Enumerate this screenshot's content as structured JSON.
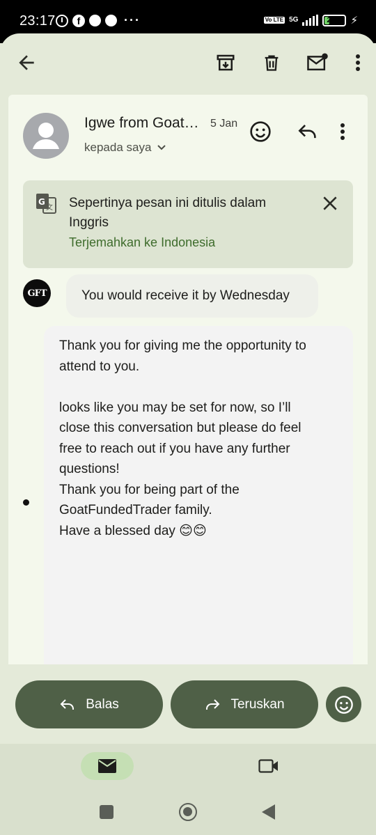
{
  "status_bar": {
    "time": "23:17",
    "network_type": "5G",
    "volte": "Vo LTE",
    "battery_percent": "24"
  },
  "header": {
    "sender": "Igwe from GoatFundedTrader",
    "date": "5 Jan",
    "recipient": "kepada saya"
  },
  "translate_banner": {
    "message": "Sepertinya pesan ini ditulis dalam Inggris",
    "action": "Terjemahkan ke Indonesia"
  },
  "messages": {
    "first": "You would receive it by Wednesday",
    "logo_text": "GFT",
    "second_lines": [
      "Thank you for giving me the opportunity to",
      "attend to you.",
      "",
      "looks like you may be set for now, so I’ll",
      "close this conversation but please do feel",
      "free to reach out if you have any further",
      "questions!",
      "Thank you for being part of the",
      "GoatFundedTrader family.",
      "Have a blessed day 😊😊"
    ]
  },
  "actions": {
    "reply_label": "Balas",
    "forward_label": "Teruskan"
  },
  "colors": {
    "app_background": "#e4ead9",
    "button_fill": "#4f6047",
    "link_green": "#3e6c2c",
    "nav_active_pill": "#c5dfb4"
  }
}
